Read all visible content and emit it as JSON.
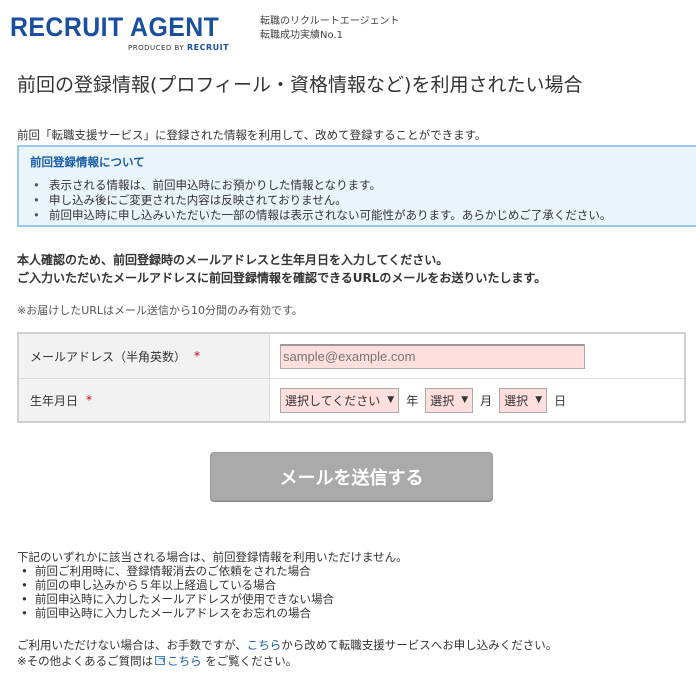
{
  "header": {
    "logo": "RECRUIT AGENT",
    "logo_produced_by": "PRODUCED BY",
    "logo_brand": "RECRUIT",
    "tagline_line1": "転職のリクルートエージェント",
    "tagline_line2": "転職成功実績No.1"
  },
  "page_title": "前回の登録情報(プロフィール・資格情報など)を利用されたい場合",
  "intro": "前回「転職支援サービス」に登録された情報を利用して、改めて登録することができます。",
  "notice": {
    "title": "前回登録情報について",
    "items": [
      "表示される情報は、前回申込時にお預かりした情報となります。",
      "申し込み後にご変更された内容は反映されておりません。",
      "前回申込時に申し込みいただいた一部の情報は表示されない可能性があります。あらかじめご了承ください。"
    ]
  },
  "confirm": {
    "line1": "本人確認のため、前回登録時のメールアドレスと生年月日を入力してください。",
    "line2": "ご入力いただいたメールアドレスに前回登録情報を確認できるURLのメールをお送りいたします。"
  },
  "url_note": "※お届けしたURLはメール送信から10分間のみ有効です。",
  "form": {
    "email_label": "メールアドレス（半角英数）",
    "required_mark": "*",
    "email_value": "",
    "email_placeholder": "sample@example.com",
    "birth_label": "生年月日",
    "year_select": "選択してください",
    "year_unit": "年",
    "month_select": "選択",
    "month_unit": "月",
    "day_select": "選択",
    "day_unit": "日",
    "arrow": "▼"
  },
  "submit_label": "メールを送信する",
  "cannot": {
    "intro": "下記のいずれかに該当される場合は、前回登録情報を利用いただけません。",
    "items": [
      "前回ご利用時に、登録情報消去のご依頼をされた場合",
      "前回の申し込みから５年以上経過している場合",
      "前回申込時に入力したメールアドレスが使用できない場合",
      "前回申込時に入力したメールアドレスをお忘れの場合"
    ]
  },
  "footer": {
    "line1_pre": "ご利用いただけない場合は、お手数ですが、",
    "line1_link": "こちら",
    "line1_post": "から改めて転職支援サービスへお申し込みください。",
    "line2_pre": "※その他よくあるご質問は",
    "line2_link": "こちら",
    "line2_post": "をご覧ください。"
  },
  "colors": {
    "brand": "#1a4fa0",
    "link": "#1a5ca8",
    "required": "#d0021b",
    "input_bg": "#ffdede",
    "notice_bg": "#eaf4fb",
    "button_disabled": "#aaaaaa"
  }
}
